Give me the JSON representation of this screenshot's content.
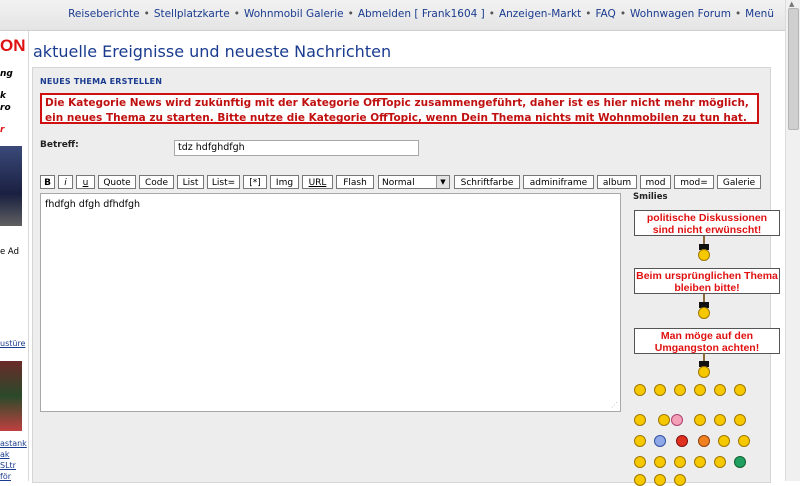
{
  "nav": {
    "links": [
      "Reiseberichte",
      "Stellplatzkarte",
      "Wohnmobil Galerie",
      "Abmelden [ Frank1604 ]",
      "Anzeigen-Markt",
      "FAQ",
      "Wohnwagen Forum",
      "Menü"
    ],
    "separator": "•"
  },
  "left_ad": {
    "logo_fragment": "ON",
    "line1": "ng",
    "line2": "k",
    "line3": "ro",
    "line4": "r",
    "ad_label": "e Ad",
    "link1": "ustüre",
    "link2": "astank",
    "link3": "ak",
    "link4": "SLtr",
    "link5": "för"
  },
  "page": {
    "title": "aktuelle Ereignisse und neueste Nachrichten"
  },
  "form": {
    "header": "NEUES THEMA ERSTELLEN",
    "notice": "Die Kategorie News wird zukünftig mit der Kategorie OffTopic zusammengeführt, daher ist es hier nicht mehr möglich, ein neues Thema zu starten. Bitte nutze die Kategorie OffTopic, wenn Dein Thema nichts mit Wohnmobilen zu tun hat.",
    "subject_label": "Betreff:",
    "subject_value": "tdz hdfghdfgh",
    "message_value": "fhdfgh dfgh dfhdfgh"
  },
  "toolbar": {
    "bold": "B",
    "italic": "i",
    "underline": "u",
    "quote": "Quote",
    "code": "Code",
    "list": "List",
    "list_eq": "List=",
    "list_item": "[*]",
    "img": "Img",
    "url": "URL",
    "flash": "Flash",
    "size_selected": "Normal",
    "font_color": "Schriftfarbe",
    "adminiframe": "adminiframe",
    "album": "album",
    "mod": "mod",
    "mod_eq": "mod=",
    "galerie": "Galerie"
  },
  "smilies": {
    "title": "Smilies",
    "signs": [
      "politische Diskussionen sind nicht erwünscht!",
      "Beim ursprünglichen Thema bleiben bitte!",
      "Man möge auf den Umgangston achten!"
    ]
  },
  "colors": {
    "link_blue": "#1a3b8f",
    "notice_red": "#c01010",
    "panel_bg": "#ededed"
  }
}
